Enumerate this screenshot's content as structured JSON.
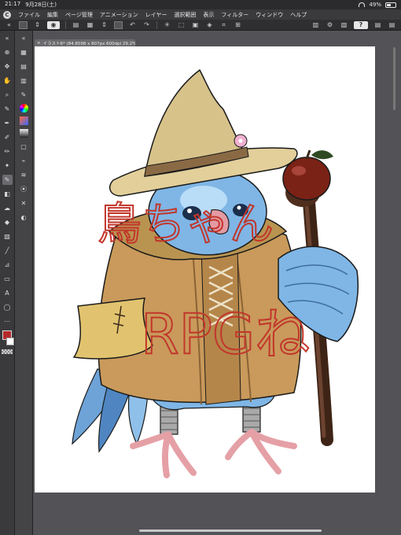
{
  "status": {
    "time": "21:17",
    "date": "9月28日(土)",
    "battery": "49%"
  },
  "menu": [
    "ファイル",
    "編集",
    "ページ管理",
    "アニメーション",
    "レイヤー",
    "選択範囲",
    "表示",
    "フィルター",
    "ウィンドウ",
    "ヘルプ"
  ],
  "command_help": "?",
  "canvas_tab": {
    "label": "イラスト6* (84.8598 x 807px 600dpi 29.2%)"
  },
  "artwork": {
    "handwriting_name": "鳥ちゃん",
    "handwriting_title": "RPGね",
    "colors": {
      "accent_red": "#c2362b",
      "hat": "#e2cf9a",
      "cloak": "#c99a5b",
      "bird_blue": "#7fb6e6",
      "staff": "#4a2b1c",
      "apple": "#7a2215"
    }
  },
  "colors": {
    "foreground": "#b52a2a",
    "background": "#ffffff"
  }
}
